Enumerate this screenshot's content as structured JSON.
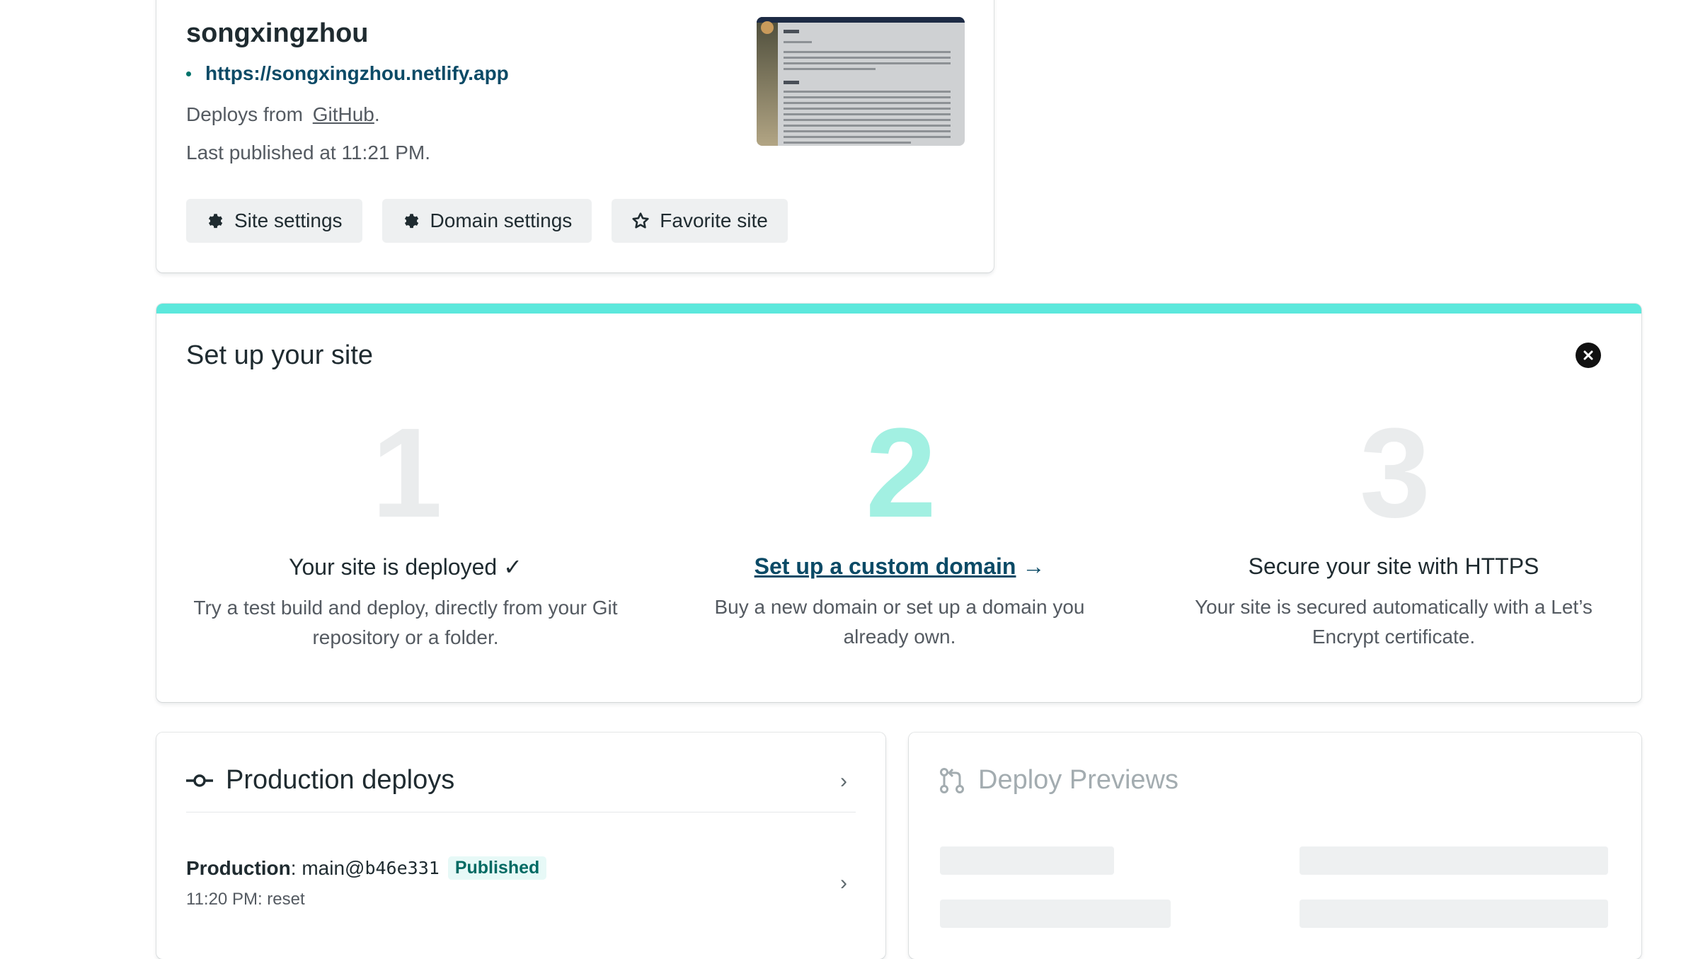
{
  "site": {
    "name": "songxingzhou",
    "url": "https://songxingzhou.netlify.app",
    "deploy_source_prefix": "Deploys from",
    "deploy_source": "GitHub",
    "deploy_source_suffix": ".",
    "last_published": "Last published at 11:21 PM."
  },
  "buttons": {
    "site_settings": "Site settings",
    "domain_settings": "Domain settings",
    "favorite_site": "Favorite site"
  },
  "setup": {
    "title": "Set up your site",
    "steps": [
      {
        "number": "1",
        "title": "Your site is deployed ✓",
        "description": "Try a test build and deploy, directly from your Git repository or a folder.",
        "color": "#eaeced"
      },
      {
        "number": "2",
        "title": "Set up a custom domain",
        "title_suffix": " →",
        "description": "Buy a new domain or set up a domain you already own.",
        "color": "#a2f0e2"
      },
      {
        "number": "3",
        "title": "Secure your site with HTTPS",
        "description": "Your site is secured automatically with a Let’s Encrypt certificate.",
        "color": "#eaeced"
      }
    ]
  },
  "production": {
    "title": "Production deploys",
    "deploy": {
      "label": "Production",
      "separator": ": ",
      "branch": "main@",
      "commit": "b46e331",
      "status": "Published",
      "meta": "11:20 PM: reset"
    }
  },
  "previews": {
    "title": "Deploy Previews"
  },
  "colors": {
    "accent_teal": "#5ce8dc",
    "link_blue": "#0b4a66",
    "published_badge_bg": "#e7f9f7"
  }
}
